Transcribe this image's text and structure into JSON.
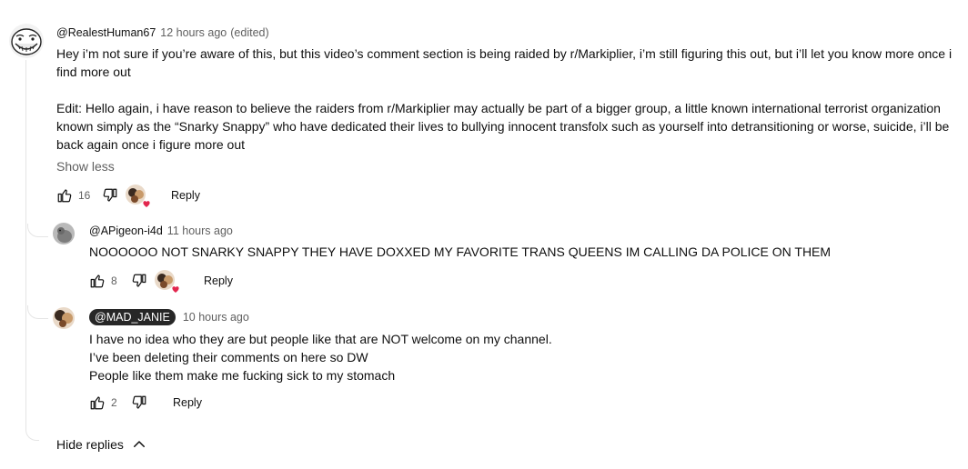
{
  "comments": [
    {
      "author": "@RealestHuman67",
      "time": "12 hours ago",
      "edited": "(edited)",
      "paragraphs": [
        "Hey i’m not sure if you’re aware of this, but this video’s comment section is being raided by r/Markiplier, i’m still figuring this out, but i’ll let you know more once i find more out",
        "Edit: Hello again, i have reason to believe the raiders from r/Markiplier may actually be part of a bigger group, a little known international terrorist organization known simply as the “Snarky Snappy” who have dedicated their lives to bullying innocent transfolx such as yourself into detransitioning or worse, suicide, i’ll be back again once i figure more out"
      ],
      "show_less": "Show less",
      "likes": "16",
      "reply_label": "Reply"
    }
  ],
  "replies": [
    {
      "author": "@APigeon-i4d",
      "time": "11 hours ago",
      "text": "NOOOOOO NOT SNARKY SNAPPY THEY HAVE DOXXED MY FAVORITE TRANS QUEENS IM CALLING DA POLICE ON THEM",
      "likes": "8",
      "reply_label": "Reply"
    },
    {
      "author": "@MAD_JANIE",
      "time": "10 hours ago",
      "lines": [
        "I have no idea who they are but people like that are NOT welcome on my channel.",
        "I’ve been deleting their comments on here so DW",
        "People like them make me fucking sick to my stomach"
      ],
      "likes": "2",
      "reply_label": "Reply"
    }
  ],
  "hide_replies_label": "Hide replies",
  "colors": {
    "text": "#0f0f0f",
    "secondary": "#606060",
    "heart": "#e2264d",
    "badge_bg": "#272727",
    "thread_line": "#e5e5e5"
  }
}
